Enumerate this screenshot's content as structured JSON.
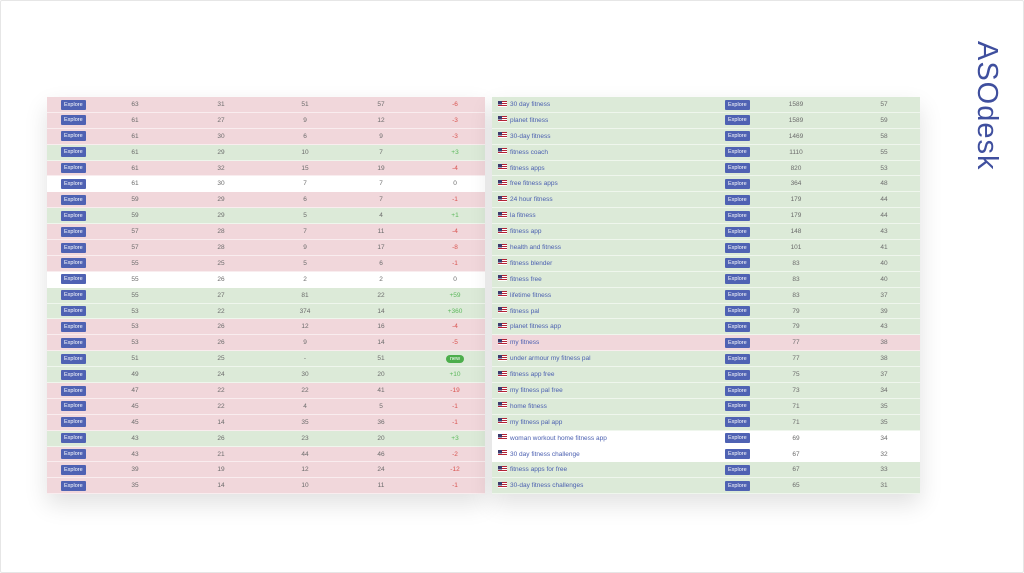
{
  "logo": {
    "text": "ASOdesk"
  },
  "colors": {
    "red_row": "#f1d7db",
    "green_row": "#dcead8",
    "white_row": "#ffffff",
    "button": "#4f62b3",
    "negative": "#d9534f",
    "positive": "#5cb85c",
    "brand": "#3f4f9e"
  },
  "left_table": {
    "button_label": "Explore",
    "rows": [
      {
        "v": [
          "63",
          "31",
          "51",
          "57",
          "-6"
        ],
        "status": "red"
      },
      {
        "v": [
          "61",
          "27",
          "9",
          "12",
          "-3"
        ],
        "status": "red"
      },
      {
        "v": [
          "61",
          "30",
          "6",
          "9",
          "-3"
        ],
        "status": "red"
      },
      {
        "v": [
          "61",
          "29",
          "10",
          "7",
          "+3"
        ],
        "status": "green"
      },
      {
        "v": [
          "61",
          "32",
          "15",
          "19",
          "-4"
        ],
        "status": "red"
      },
      {
        "v": [
          "61",
          "30",
          "7",
          "7",
          "0"
        ],
        "status": "white"
      },
      {
        "v": [
          "59",
          "29",
          "6",
          "7",
          "-1"
        ],
        "status": "red"
      },
      {
        "v": [
          "59",
          "29",
          "5",
          "4",
          "+1"
        ],
        "status": "green"
      },
      {
        "v": [
          "57",
          "28",
          "7",
          "11",
          "-4"
        ],
        "status": "red"
      },
      {
        "v": [
          "57",
          "28",
          "9",
          "17",
          "-8"
        ],
        "status": "red"
      },
      {
        "v": [
          "55",
          "25",
          "5",
          "6",
          "-1"
        ],
        "status": "red"
      },
      {
        "v": [
          "55",
          "26",
          "2",
          "2",
          "0"
        ],
        "status": "white"
      },
      {
        "v": [
          "55",
          "27",
          "81",
          "22",
          "+59"
        ],
        "status": "green"
      },
      {
        "v": [
          "53",
          "22",
          "374",
          "14",
          "+360"
        ],
        "status": "green"
      },
      {
        "v": [
          "53",
          "26",
          "12",
          "16",
          "-4"
        ],
        "status": "red"
      },
      {
        "v": [
          "53",
          "26",
          "9",
          "14",
          "-5"
        ],
        "status": "red"
      },
      {
        "v": [
          "51",
          "25",
          "-",
          "51",
          "new"
        ],
        "status": "green"
      },
      {
        "v": [
          "49",
          "24",
          "30",
          "20",
          "+10"
        ],
        "status": "green"
      },
      {
        "v": [
          "47",
          "22",
          "22",
          "41",
          "-19"
        ],
        "status": "red"
      },
      {
        "v": [
          "45",
          "22",
          "4",
          "5",
          "-1"
        ],
        "status": "red"
      },
      {
        "v": [
          "45",
          "14",
          "35",
          "36",
          "-1"
        ],
        "status": "red"
      },
      {
        "v": [
          "43",
          "26",
          "23",
          "20",
          "+3"
        ],
        "status": "green"
      },
      {
        "v": [
          "43",
          "21",
          "44",
          "46",
          "-2"
        ],
        "status": "red"
      },
      {
        "v": [
          "39",
          "19",
          "12",
          "24",
          "-12"
        ],
        "status": "red"
      },
      {
        "v": [
          "35",
          "14",
          "10",
          "11",
          "-1"
        ],
        "status": "red"
      }
    ]
  },
  "right_table": {
    "button_label": "Explore",
    "rows": [
      {
        "keyword": "30 day fitness",
        "v": [
          "1589",
          "57"
        ],
        "status": "green"
      },
      {
        "keyword": "planet fitness",
        "v": [
          "1589",
          "59"
        ],
        "status": "green"
      },
      {
        "keyword": "30-day fitness",
        "v": [
          "1469",
          "58"
        ],
        "status": "green"
      },
      {
        "keyword": "fitness coach",
        "v": [
          "1110",
          "55"
        ],
        "status": "green"
      },
      {
        "keyword": "fitness apps",
        "v": [
          "820",
          "53"
        ],
        "status": "green"
      },
      {
        "keyword": "free fitness apps",
        "v": [
          "364",
          "48"
        ],
        "status": "green"
      },
      {
        "keyword": "24 hour fitness",
        "v": [
          "179",
          "44"
        ],
        "status": "green"
      },
      {
        "keyword": "la fitness",
        "v": [
          "179",
          "44"
        ],
        "status": "green"
      },
      {
        "keyword": "fitness app",
        "v": [
          "148",
          "43"
        ],
        "status": "green"
      },
      {
        "keyword": "health and fitness",
        "v": [
          "101",
          "41"
        ],
        "status": "green"
      },
      {
        "keyword": "fitness blender",
        "v": [
          "83",
          "40"
        ],
        "status": "green"
      },
      {
        "keyword": "fitness free",
        "v": [
          "83",
          "40"
        ],
        "status": "green"
      },
      {
        "keyword": "lifetime fitness",
        "v": [
          "83",
          "37"
        ],
        "status": "green"
      },
      {
        "keyword": "fitness pal",
        "v": [
          "79",
          "39"
        ],
        "status": "green"
      },
      {
        "keyword": "planet fitness app",
        "v": [
          "79",
          "43"
        ],
        "status": "green"
      },
      {
        "keyword": "my fitness",
        "v": [
          "77",
          "38"
        ],
        "status": "red"
      },
      {
        "keyword": "under armour my fitness pal",
        "v": [
          "77",
          "38"
        ],
        "status": "green"
      },
      {
        "keyword": "fitness app free",
        "v": [
          "75",
          "37"
        ],
        "status": "green"
      },
      {
        "keyword": "my fitness pal free",
        "v": [
          "73",
          "34"
        ],
        "status": "green"
      },
      {
        "keyword": "home fitness",
        "v": [
          "71",
          "35"
        ],
        "status": "green"
      },
      {
        "keyword": "my fitness pal app",
        "v": [
          "71",
          "35"
        ],
        "status": "green"
      },
      {
        "keyword": "woman workout home fitness app",
        "v": [
          "69",
          "34"
        ],
        "status": "white"
      },
      {
        "keyword": "30 day fitness challenge",
        "v": [
          "67",
          "32"
        ],
        "status": "white"
      },
      {
        "keyword": "fitness apps for free",
        "v": [
          "67",
          "33"
        ],
        "status": "green"
      },
      {
        "keyword": "30-day fitness challenges",
        "v": [
          "65",
          "31"
        ],
        "status": "green"
      }
    ]
  }
}
